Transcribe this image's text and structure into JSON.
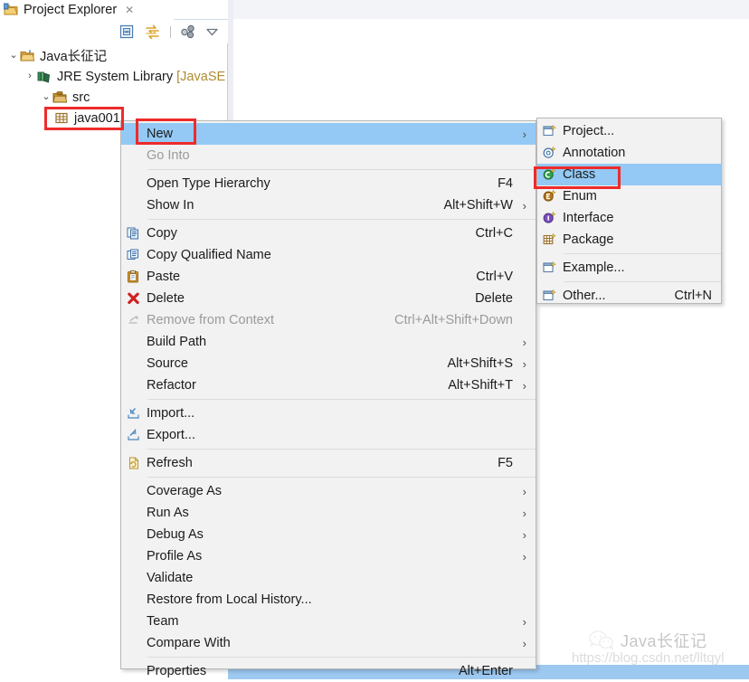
{
  "view": {
    "tab_title": "Project Explorer",
    "close_glyph": "✕",
    "toolbar": [
      {
        "name": "collapse-all-icon",
        "tooltip": "Collapse All"
      },
      {
        "name": "link-with-editor-icon",
        "tooltip": "Link with Editor"
      },
      {
        "name": "view-menu-filters-icon",
        "tooltip": "Filters"
      },
      {
        "name": "view-menu-icon",
        "tooltip": "View Menu"
      }
    ],
    "window_buttons": [
      {
        "name": "minimize-button",
        "label": "—"
      },
      {
        "name": "maximize-button",
        "label": "❐"
      }
    ]
  },
  "tree": {
    "nodes": [
      {
        "label": "Java长征记",
        "suffix": "",
        "twisty": "⌄",
        "icon": "java-project-icon",
        "indent": 1
      },
      {
        "label": "JRE System Library ",
        "suffix": "[JavaSE",
        "twisty": "›",
        "icon": "jre-library-icon",
        "indent": 2
      },
      {
        "label": "src",
        "suffix": "",
        "twisty": "⌄",
        "icon": "source-folder-icon",
        "indent": 3
      },
      {
        "label": "java001",
        "suffix": "",
        "twisty": "",
        "icon": "package-icon",
        "indent": 4
      }
    ]
  },
  "context_menu": {
    "items": [
      {
        "label": "New",
        "accel": "",
        "arrow": true,
        "selected": true,
        "disabled": false,
        "icon": ""
      },
      {
        "label": "Go Into",
        "accel": "",
        "arrow": false,
        "selected": false,
        "disabled": true,
        "icon": ""
      },
      {
        "separator": true
      },
      {
        "label": "Open Type Hierarchy",
        "accel": "F4",
        "arrow": false,
        "selected": false,
        "disabled": false,
        "icon": ""
      },
      {
        "label": "Show In",
        "accel": "Alt+Shift+W",
        "arrow": true,
        "selected": false,
        "disabled": false,
        "icon": ""
      },
      {
        "separator": true
      },
      {
        "label": "Copy",
        "accel": "Ctrl+C",
        "arrow": false,
        "selected": false,
        "disabled": false,
        "icon": "copy-icon"
      },
      {
        "label": "Copy Qualified Name",
        "accel": "",
        "arrow": false,
        "selected": false,
        "disabled": false,
        "icon": "copy-qualified-name-icon"
      },
      {
        "label": "Paste",
        "accel": "Ctrl+V",
        "arrow": false,
        "selected": false,
        "disabled": false,
        "icon": "paste-icon"
      },
      {
        "label": "Delete",
        "accel": "Delete",
        "arrow": false,
        "selected": false,
        "disabled": false,
        "icon": "delete-icon"
      },
      {
        "label": "Remove from Context",
        "accel": "Ctrl+Alt+Shift+Down",
        "arrow": false,
        "selected": false,
        "disabled": true,
        "icon": "remove-from-context-icon"
      },
      {
        "label": "Build Path",
        "accel": "",
        "arrow": true,
        "selected": false,
        "disabled": false,
        "icon": ""
      },
      {
        "label": "Source",
        "accel": "Alt+Shift+S",
        "arrow": true,
        "selected": false,
        "disabled": false,
        "icon": ""
      },
      {
        "label": "Refactor",
        "accel": "Alt+Shift+T",
        "arrow": true,
        "selected": false,
        "disabled": false,
        "icon": ""
      },
      {
        "separator": true
      },
      {
        "label": "Import...",
        "accel": "",
        "arrow": false,
        "selected": false,
        "disabled": false,
        "icon": "import-icon"
      },
      {
        "label": "Export...",
        "accel": "",
        "arrow": false,
        "selected": false,
        "disabled": false,
        "icon": "export-icon"
      },
      {
        "separator": true
      },
      {
        "label": "Refresh",
        "accel": "F5",
        "arrow": false,
        "selected": false,
        "disabled": false,
        "icon": "refresh-icon"
      },
      {
        "separator": true
      },
      {
        "label": "Coverage As",
        "accel": "",
        "arrow": true,
        "selected": false,
        "disabled": false,
        "icon": ""
      },
      {
        "label": "Run As",
        "accel": "",
        "arrow": true,
        "selected": false,
        "disabled": false,
        "icon": ""
      },
      {
        "label": "Debug As",
        "accel": "",
        "arrow": true,
        "selected": false,
        "disabled": false,
        "icon": ""
      },
      {
        "label": "Profile As",
        "accel": "",
        "arrow": true,
        "selected": false,
        "disabled": false,
        "icon": ""
      },
      {
        "label": "Validate",
        "accel": "",
        "arrow": false,
        "selected": false,
        "disabled": false,
        "icon": ""
      },
      {
        "label": "Restore from Local History...",
        "accel": "",
        "arrow": false,
        "selected": false,
        "disabled": false,
        "icon": ""
      },
      {
        "label": "Team",
        "accel": "",
        "arrow": true,
        "selected": false,
        "disabled": false,
        "icon": ""
      },
      {
        "label": "Compare With",
        "accel": "",
        "arrow": true,
        "selected": false,
        "disabled": false,
        "icon": ""
      },
      {
        "separator": true
      },
      {
        "label": "Properties",
        "accel": "Alt+Enter",
        "arrow": false,
        "selected": false,
        "disabled": false,
        "icon": ""
      }
    ]
  },
  "new_submenu": {
    "items": [
      {
        "label": "Project...",
        "accel": "",
        "selected": false,
        "icon": "new-project-icon"
      },
      {
        "label": "Annotation",
        "accel": "",
        "selected": false,
        "icon": "new-annotation-icon"
      },
      {
        "label": "Class",
        "accel": "",
        "selected": true,
        "icon": "new-class-icon"
      },
      {
        "label": "Enum",
        "accel": "",
        "selected": false,
        "icon": "new-enum-icon"
      },
      {
        "label": "Interface",
        "accel": "",
        "selected": false,
        "icon": "new-interface-icon"
      },
      {
        "label": "Package",
        "accel": "",
        "selected": false,
        "icon": "new-package-icon"
      },
      {
        "separator": true
      },
      {
        "label": "Example...",
        "accel": "",
        "selected": false,
        "icon": "new-example-icon"
      },
      {
        "separator": true
      },
      {
        "label": "Other...",
        "accel": "Ctrl+N",
        "selected": false,
        "icon": "new-other-icon"
      }
    ]
  },
  "annotations": {
    "highlights": [
      {
        "name": "tree-node-highlight",
        "target": "java001"
      },
      {
        "name": "new-menu-highlight",
        "target": "New"
      },
      {
        "name": "class-submenu-highlight",
        "target": "Class"
      }
    ],
    "color": "#ee2b2b"
  },
  "watermark": {
    "brand": "Java长征记",
    "url": "https://blog.csdn.net/lltqyl",
    "logo_icon": "wechat-icon"
  },
  "colors": {
    "menu_bg": "#f2f2f2",
    "menu_border": "#b9b9b9",
    "selection": "#93c9f4",
    "accent_red": "#ee2b2b",
    "text": "#1b1b1b",
    "disabled_text": "#9a9a9a",
    "tab_bg": "#cfdcec"
  }
}
